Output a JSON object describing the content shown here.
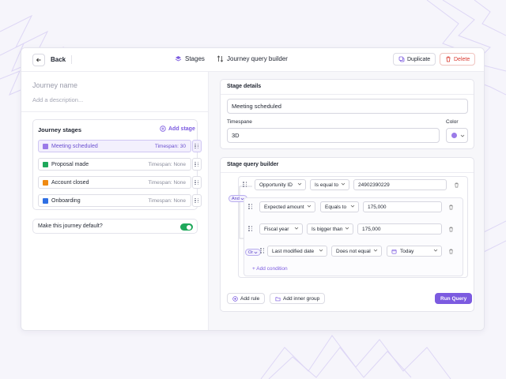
{
  "header": {
    "back_label": "Back",
    "stages_tab_label": "Stages",
    "query_tab_label": "Journey query builder",
    "duplicate_label": "Duplicate",
    "delete_label": "Delete"
  },
  "journey": {
    "name_placeholder": "Journey name",
    "description_placeholder": "Add a description..."
  },
  "stages_panel": {
    "title": "Journey stages",
    "add_label": "Add stage",
    "stages": [
      {
        "label": "Meeting scheduled",
        "timespan": "Timespan: 30",
        "color": "#9b7be8",
        "active": true
      },
      {
        "label": "Proposal made",
        "timespan": "Timespan: None",
        "color": "#1fa85b",
        "active": false
      },
      {
        "label": "Account closed",
        "timespan": "Timespan: None",
        "color": "#ef8a12",
        "active": false
      },
      {
        "label": "Onboarding",
        "timespan": "Timespan: None",
        "color": "#2f6fe4",
        "active": false
      }
    ]
  },
  "default_toggle": {
    "label": "Make this journey default?",
    "on": true
  },
  "stage_details": {
    "title": "Stage details",
    "name_value": "Meeting scheduled",
    "timespan_label": "Timespane",
    "timespan_value": "3D",
    "color_label": "Color",
    "color_value": "#9b7be8"
  },
  "query_builder": {
    "title": "Stage query builder",
    "top_and": "And",
    "rule1": {
      "field": "Opportunity ID",
      "op": "Is equal to",
      "value": "24902390229"
    },
    "group": {
      "rules": [
        {
          "field": "Expected amount",
          "op": "Equals to",
          "value": "175,000"
        },
        {
          "field": "Fiscal year",
          "op": "Is bigger than",
          "value": "175,000"
        }
      ],
      "or_label": "Or",
      "date_rule": {
        "field": "Last modified date",
        "op": "Does not equal",
        "value": "Today"
      },
      "add_condition_label": "+ Add condition"
    },
    "add_rule_label": "Add rule",
    "add_group_label": "Add inner group",
    "run_label": "Run Query"
  },
  "colors": {
    "accent": "#7c5be0",
    "danger": "#d9382f",
    "toggle_on": "#1fa85b"
  }
}
